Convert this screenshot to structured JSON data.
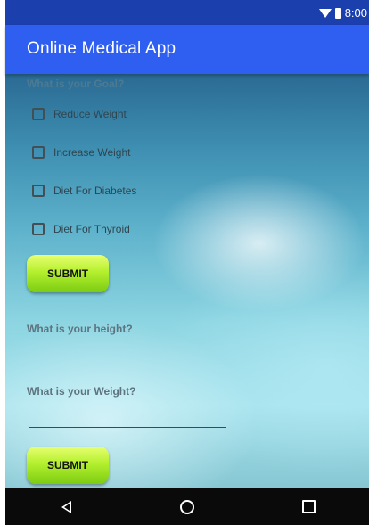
{
  "status_bar": {
    "time": "8:00",
    "icons": [
      "wifi-icon",
      "battery-icon"
    ]
  },
  "app_bar": {
    "title": "Online Medical App",
    "color": "#2f5ff0"
  },
  "goal_section": {
    "question": "What is your Goal?",
    "options": [
      {
        "label": "Reduce Weight",
        "checked": false
      },
      {
        "label": "Increase Weight",
        "checked": false
      },
      {
        "label": "Diet For Diabetes",
        "checked": false
      },
      {
        "label": "Diet For Thyroid",
        "checked": false
      }
    ],
    "submit_label": "SUBMIT"
  },
  "measure_section": {
    "height_question": "What is your height?",
    "height_value": "",
    "weight_question": "What is your Weight?",
    "weight_value": "",
    "submit_label": "SUBMIT"
  },
  "nav_bar": {
    "buttons": [
      "back-icon",
      "home-icon",
      "recents-icon"
    ]
  },
  "colors": {
    "button_gradient_top": "#e8ff70",
    "button_gradient_bottom": "#7bcc12",
    "status_bar": "#1c3fae",
    "nav_bar": "#0a0a0a"
  }
}
